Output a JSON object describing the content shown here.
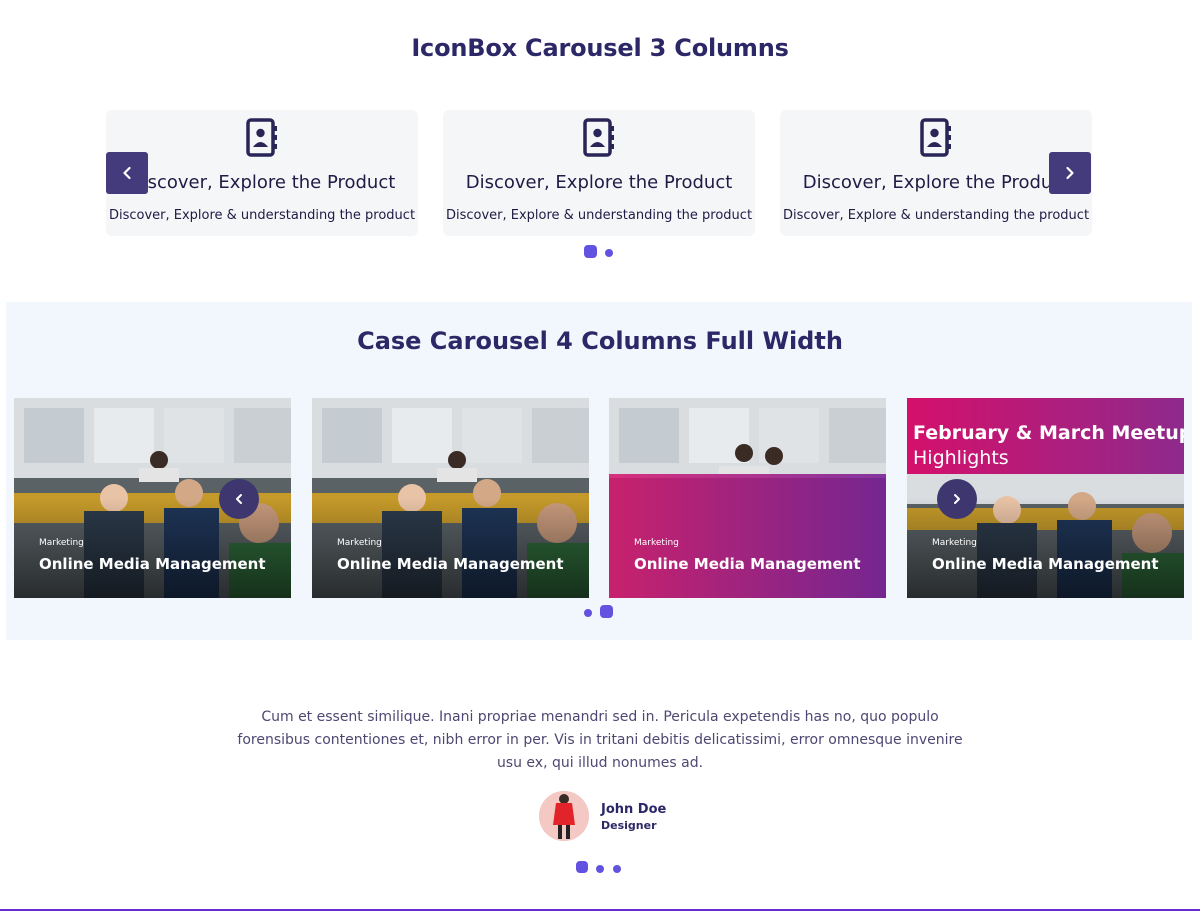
{
  "iconbox_section": {
    "title": "IconBox Carousel 3 Columns",
    "cards": [
      {
        "icon": "contact-book-icon",
        "title": "Discover, Explore the Product",
        "text": "Discover, Explore & understanding the product"
      },
      {
        "icon": "contact-book-icon",
        "title": "Discover, Explore the Product",
        "text": "Discover, Explore & understanding the product"
      },
      {
        "icon": "contact-book-icon",
        "title": "Discover, Explore the Product",
        "text": "Discover, Explore & understanding the product"
      }
    ],
    "prev_icon": "chevron-left-icon",
    "next_icon": "chevron-right-icon",
    "pagination": {
      "count": 2,
      "active": 1
    }
  },
  "case_section": {
    "title": "Case Carousel 4 Columns Full Width",
    "cards": [
      {
        "category": "Marketing",
        "title": "Online Media Management"
      },
      {
        "category": "Marketing",
        "title": "Online Media Management"
      },
      {
        "category": "Marketing",
        "title": "Online Media Management"
      },
      {
        "category": "Marketing",
        "title": "Online Media Management",
        "banner_title": "February & March Meetups",
        "banner_subtitle": "Highlights"
      }
    ],
    "prev_icon": "chevron-left-icon",
    "next_icon": "chevron-right-icon",
    "pagination": {
      "count": 2,
      "active": 2
    }
  },
  "testimonial_section": {
    "quote": "Cum et essent similique. Inani propriae menandri sed in. Pericula expetendis has no, quo populo forensibus contentiones et, nibh error in per. Vis in tritani debitis delicatissimi, error omnesque invenire usu ex, qui illud nonumes ad.",
    "author": {
      "name": "John Doe",
      "role": "Designer"
    },
    "pagination": {
      "count": 3,
      "active": 1
    }
  },
  "colors": {
    "heading": "#2c2766",
    "accent": "#6152e0",
    "nav_button": "#433b7c",
    "section_bg": "#f2f6fd",
    "pink": "#d4106b"
  }
}
